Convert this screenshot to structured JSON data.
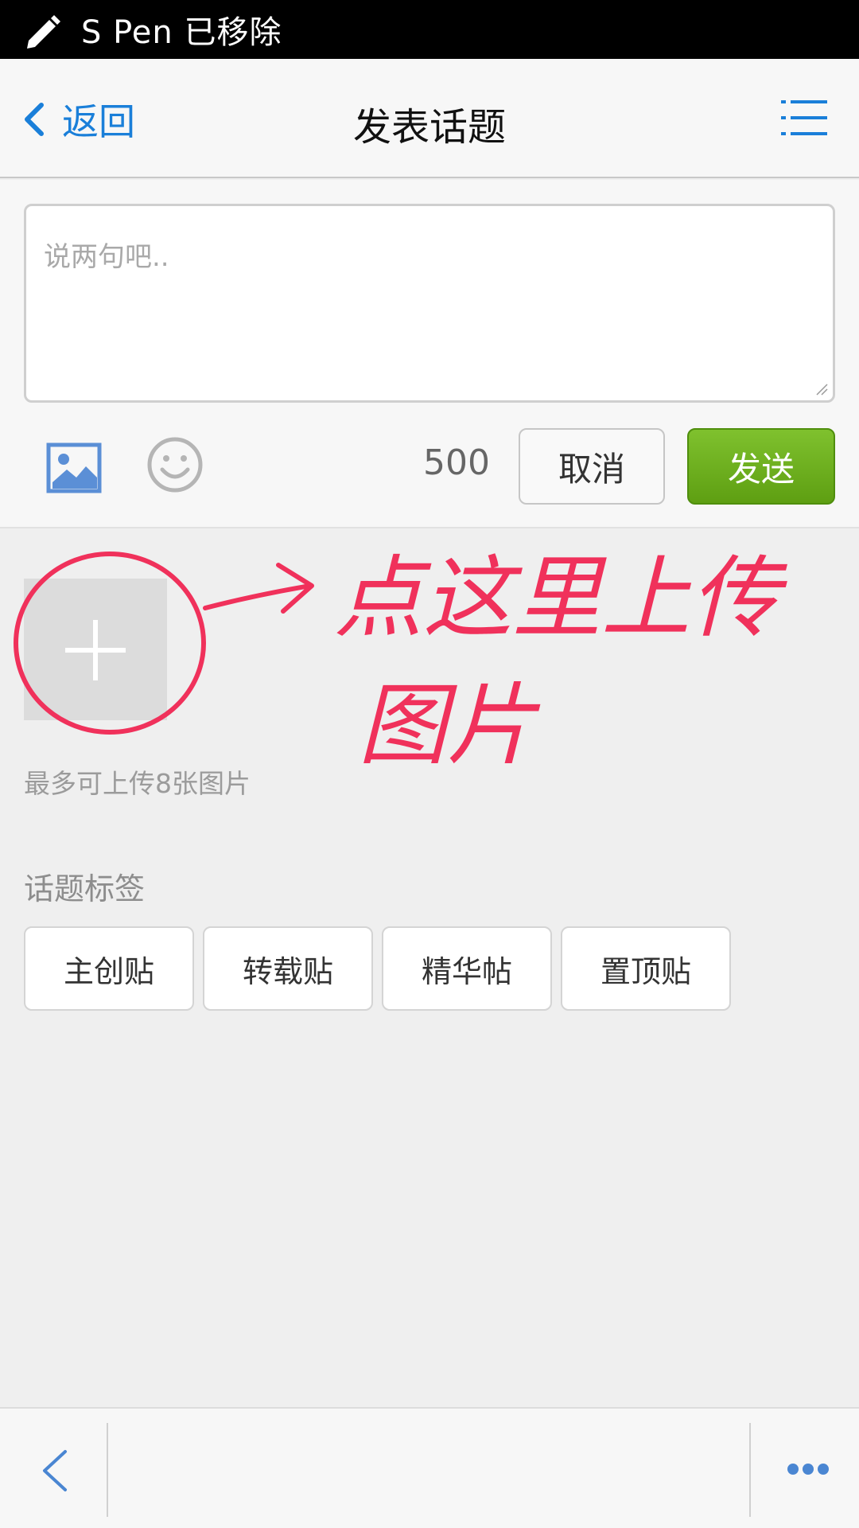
{
  "status_bar": {
    "text": "S Pen 已移除"
  },
  "nav": {
    "back_label": "返回",
    "title": "发表话题"
  },
  "compose": {
    "placeholder": "说两句吧..",
    "char_count": "500",
    "cancel_label": "取消",
    "send_label": "发送"
  },
  "upload": {
    "hint": "最多可上传8张图片"
  },
  "tags": {
    "title": "话题标签",
    "items": [
      {
        "label": "主创贴"
      },
      {
        "label": "转载贴"
      },
      {
        "label": "精华帖"
      },
      {
        "label": "置顶贴"
      }
    ]
  },
  "annotation": {
    "line1": "点这里上传",
    "line2": "图片"
  },
  "colors": {
    "accent": "#1a7fd9",
    "send_green": "#6db01f",
    "annotation_red": "#f0315b"
  }
}
